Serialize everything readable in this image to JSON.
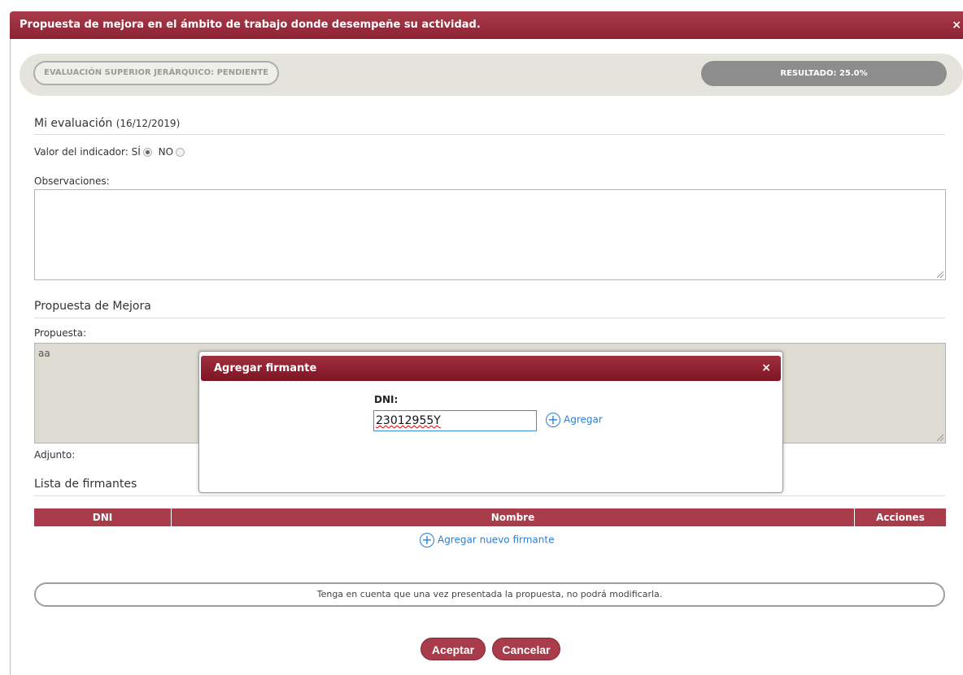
{
  "window": {
    "title": "Propuesta de mejora en el ámbito de trabajo donde desempeñe su actividad.",
    "close_glyph": "×"
  },
  "status": {
    "evaluation": "EVALUACIÓN SUPERIOR JERÁRQUICO: PENDIENTE",
    "result": "RESULTADO: 25.0%"
  },
  "my_evaluation": {
    "heading": "Mi evaluación",
    "date": "(16/12/2019)",
    "indicator_label": "Valor del indicador:",
    "yes_label": "SÍ",
    "no_label": "NO",
    "selected": "SÍ",
    "observations_label": "Observaciones:",
    "observations_value": ""
  },
  "proposal": {
    "heading": "Propuesta de Mejora",
    "proposal_label": "Propuesta:",
    "proposal_value": "aa",
    "attachment_label": "Adjunto:"
  },
  "signers": {
    "heading": "Lista de firmantes",
    "columns": [
      "DNI",
      "Nombre",
      "Acciones"
    ],
    "add_label": "Agregar nuevo firmante"
  },
  "notice": "Tenga en cuenta que una vez presentada la propuesta, no podrá modificarla.",
  "buttons": {
    "accept": "Aceptar",
    "cancel": "Cancelar"
  },
  "modal": {
    "title": "Agregar firmante",
    "close_glyph": "×",
    "dni_label": "DNI:",
    "dni_value": "23012955Y",
    "add_label": "Agregar"
  },
  "colors": {
    "brand": "#a83c4a",
    "link": "#2a7fcf"
  }
}
